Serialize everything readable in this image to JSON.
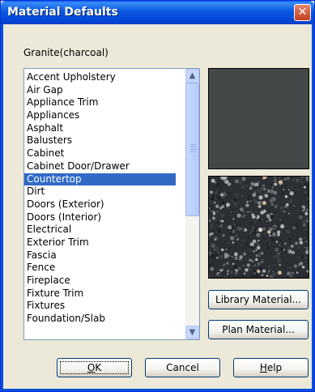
{
  "window": {
    "title": "Material Defaults",
    "close_glyph": "✕"
  },
  "material": {
    "name": "Granite(charcoal)"
  },
  "list": {
    "items": [
      "Accent Upholstery",
      "Air Gap",
      "Appliance Trim",
      "Appliances",
      "Asphalt",
      "Balusters",
      "Cabinet",
      "Cabinet Door/Drawer",
      "Countertop",
      "Dirt",
      "Doors (Exterior)",
      "Doors (Interior)",
      "Electrical",
      "Exterior Trim",
      "Fascia",
      "Fence",
      "Fireplace",
      "Fixture Trim",
      "Fixtures",
      "Foundation/Slab"
    ],
    "selected": "Countertop",
    "scroll_up_glyph": "▲",
    "scroll_down_glyph": "▼"
  },
  "preview": {
    "solid_color": "#444849",
    "texture_base_color": "#2B2F33"
  },
  "buttons": {
    "library_material": "Library Material...",
    "plan_material": "Plan Material...",
    "ok_mnemonic": "O",
    "ok_rest": "K",
    "cancel": "Cancel",
    "help_mnemonic": "H",
    "help_rest": "elp"
  }
}
